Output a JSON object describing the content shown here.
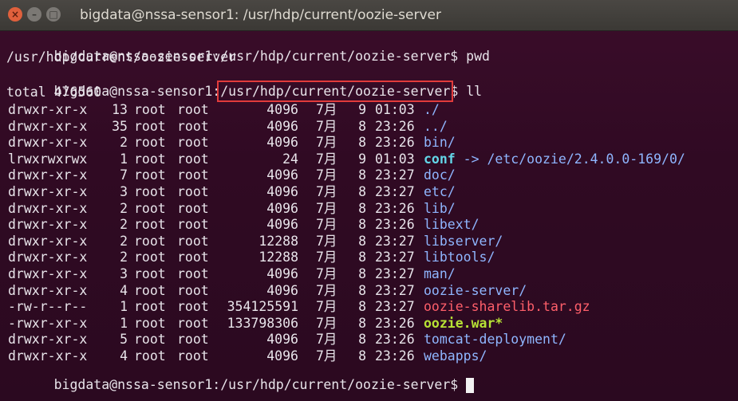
{
  "window": {
    "title": "bigdata@nssa-sensor1: /usr/hdp/current/oozie-server",
    "close_glyph": "×",
    "min_glyph": "–",
    "max_glyph": "□"
  },
  "terminal": {
    "line1_prompt": "bigdata@nssa-sensor1:/usr/hdp/current/oozie-server$",
    "line1_cmd": " pwd",
    "line2_output": "/usr/hdp/current/oozie-server",
    "line3_prompt_host": "bigdata@nssa-sensor1:",
    "line3_prompt_path": "/usr/hdp/current/oozie-server",
    "line3_prompt_tail": "$ ll",
    "total": "total 476560",
    "rows": [
      {
        "perm": "drwxr-xr-x",
        "links": "13",
        "user": "root",
        "group": "root",
        "size": "4096",
        "mon": "7月",
        "day": "9",
        "time": "01:03",
        "name": "./",
        "kind": "dir",
        "target": ""
      },
      {
        "perm": "drwxr-xr-x",
        "links": "35",
        "user": "root",
        "group": "root",
        "size": "4096",
        "mon": "7月",
        "day": "8",
        "time": "23:26",
        "name": "../",
        "kind": "dir",
        "target": ""
      },
      {
        "perm": "drwxr-xr-x",
        "links": "2",
        "user": "root",
        "group": "root",
        "size": "4096",
        "mon": "7月",
        "day": "8",
        "time": "23:26",
        "name": "bin/",
        "kind": "dir",
        "target": ""
      },
      {
        "perm": "lrwxrwxrwx",
        "links": "1",
        "user": "root",
        "group": "root",
        "size": "24",
        "mon": "7月",
        "day": "9",
        "time": "01:03",
        "name": "conf",
        "kind": "link",
        "target": " -> /etc/oozie/2.4.0.0-169/0/"
      },
      {
        "perm": "drwxr-xr-x",
        "links": "7",
        "user": "root",
        "group": "root",
        "size": "4096",
        "mon": "7月",
        "day": "8",
        "time": "23:27",
        "name": "doc/",
        "kind": "dir",
        "target": ""
      },
      {
        "perm": "drwxr-xr-x",
        "links": "3",
        "user": "root",
        "group": "root",
        "size": "4096",
        "mon": "7月",
        "day": "8",
        "time": "23:27",
        "name": "etc/",
        "kind": "dir",
        "target": ""
      },
      {
        "perm": "drwxr-xr-x",
        "links": "2",
        "user": "root",
        "group": "root",
        "size": "4096",
        "mon": "7月",
        "day": "8",
        "time": "23:26",
        "name": "lib/",
        "kind": "dir",
        "target": ""
      },
      {
        "perm": "drwxr-xr-x",
        "links": "2",
        "user": "root",
        "group": "root",
        "size": "4096",
        "mon": "7月",
        "day": "8",
        "time": "23:26",
        "name": "libext/",
        "kind": "dir",
        "target": ""
      },
      {
        "perm": "drwxr-xr-x",
        "links": "2",
        "user": "root",
        "group": "root",
        "size": "12288",
        "mon": "7月",
        "day": "8",
        "time": "23:27",
        "name": "libserver/",
        "kind": "dir",
        "target": ""
      },
      {
        "perm": "drwxr-xr-x",
        "links": "2",
        "user": "root",
        "group": "root",
        "size": "12288",
        "mon": "7月",
        "day": "8",
        "time": "23:27",
        "name": "libtools/",
        "kind": "dir",
        "target": ""
      },
      {
        "perm": "drwxr-xr-x",
        "links": "3",
        "user": "root",
        "group": "root",
        "size": "4096",
        "mon": "7月",
        "day": "8",
        "time": "23:27",
        "name": "man/",
        "kind": "dir",
        "target": ""
      },
      {
        "perm": "drwxr-xr-x",
        "links": "4",
        "user": "root",
        "group": "root",
        "size": "4096",
        "mon": "7月",
        "day": "8",
        "time": "23:27",
        "name": "oozie-server/",
        "kind": "dir",
        "target": ""
      },
      {
        "perm": "-rw-r--r--",
        "links": "1",
        "user": "root",
        "group": "root",
        "size": "354125591",
        "mon": "7月",
        "day": "8",
        "time": "23:27",
        "name": "oozie-sharelib.tar.gz",
        "kind": "archive",
        "target": ""
      },
      {
        "perm": "-rwxr-xr-x",
        "links": "1",
        "user": "root",
        "group": "root",
        "size": "133798306",
        "mon": "7月",
        "day": "8",
        "time": "23:26",
        "name": "oozie.war*",
        "kind": "exec",
        "target": ""
      },
      {
        "perm": "drwxr-xr-x",
        "links": "5",
        "user": "root",
        "group": "root",
        "size": "4096",
        "mon": "7月",
        "day": "8",
        "time": "23:26",
        "name": "tomcat-deployment/",
        "kind": "dir",
        "target": ""
      },
      {
        "perm": "drwxr-xr-x",
        "links": "4",
        "user": "root",
        "group": "root",
        "size": "4096",
        "mon": "7月",
        "day": "8",
        "time": "23:26",
        "name": "webapps/",
        "kind": "dir",
        "target": ""
      }
    ],
    "last_prompt": "bigdata@nssa-sensor1:/usr/hdp/current/oozie-server$ "
  },
  "colors": {
    "background": "#300a23",
    "dir": "#8fb6ff",
    "link": "#63d6e8",
    "archive": "#ff5f6a",
    "exec": "#b7e235",
    "highlight_box": "#e23b3b"
  }
}
